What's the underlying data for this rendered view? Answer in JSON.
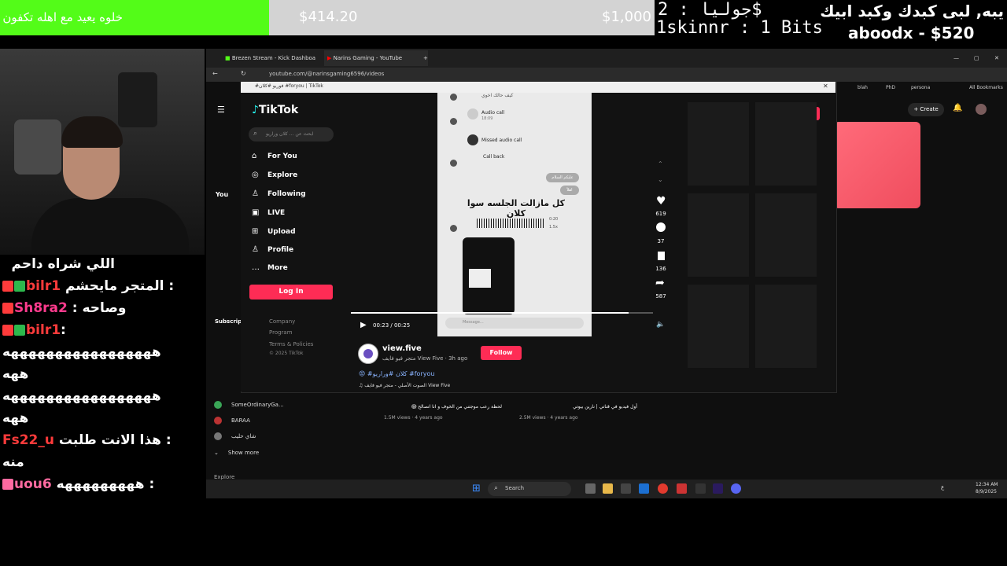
{
  "overlay": {
    "banner_text": "خلوه يعيد مع اهله تكفون",
    "bar_current": "$414.20",
    "bar_goal": "$1,000",
    "donor_mid_line1": "جوليا : 2$",
    "donor_mid_line2": "1skinnr : 1 Bits",
    "donor_right_line1": "يبه, لبى كبدك وكبد ابيك",
    "donor_right_line2": "aboodx - $520"
  },
  "chat": [
    {
      "user": "",
      "text": "اللي شراه داحم",
      "user_color": "#ffffff"
    },
    {
      "user": "bilr1",
      "text": "المتجر مايحشم :",
      "user_color": "#ff3b3b"
    },
    {
      "user": "Sh8ra2",
      "text": ": وصاحه",
      "user_color": "#ff3b8d"
    },
    {
      "user": "bilr1",
      "text": ":",
      "user_color": "#ff3b3b"
    },
    {
      "user": "",
      "text": "هههههههههههههههههه",
      "user_color": "#ffffff"
    },
    {
      "user": "",
      "text": "ههه",
      "user_color": "#ffffff"
    },
    {
      "user": "",
      "text": "هههههههههههههههههه",
      "user_color": "#ffffff"
    },
    {
      "user": "",
      "text": "ههه",
      "user_color": "#ffffff"
    },
    {
      "user": "Fs22_u",
      "text": "هذا الانت طلبت :",
      "user_color": "#ff3b3b"
    },
    {
      "user": "",
      "text": "منه",
      "user_color": "#ffffff"
    },
    {
      "user": "uou6",
      "text": "هههههههههه :",
      "user_color": "#ff6aa0"
    }
  ],
  "browser": {
    "tabs": [
      "Brezen Stream - Kick Dashboa",
      "Narins Gaming - YouTube"
    ],
    "url": "youtube.com/@narinsgaming6596/videos",
    "bookmarks": [
      "blah",
      "PhD",
      "persona",
      "All Bookmarks"
    ],
    "create_label": "Create"
  },
  "youtube_sidebar": {
    "you_label": "You",
    "subscriptions_label": "Subscrip",
    "subs": [
      "SomeOrdinaryGa...",
      "BARAA",
      "شاي حليب"
    ],
    "show_more": "Show more",
    "explore": "Explore"
  },
  "youtube_videos": [
    {
      "title": "لحظة رعب موجتني من الخوف و انا انصالح 😱",
      "meta": "1.5M views · 4 years ago"
    },
    {
      "title": "أول فيديو في قناتي | نارين بيوتي",
      "meta": "2.5M views · 4 years ago"
    }
  ],
  "tiktok": {
    "window_title": "#فوريو #كلان #foryou | TikTok",
    "logo": "TikTok",
    "search_placeholder": "ابحث عن ... كلان وراريو",
    "nav": [
      "For You",
      "Explore",
      "Following",
      "LIVE",
      "Upload",
      "Profile",
      "More"
    ],
    "login": "Log In",
    "footer": [
      "Company",
      "Program",
      "Terms & Policies",
      "© 2025 TikTok"
    ],
    "video_chat": {
      "top": "كيف حالك اخوي",
      "audio_call": "Audio call",
      "audio_time": "18:09",
      "missed": "Missed audio call",
      "call_back": "Call back",
      "bubble1": "عليكم السلام",
      "bubble2": "اهلاً",
      "caption": "كل مازالت الجلسه سوا كلان",
      "voice_len": "0:20",
      "speed": "1.5x",
      "message_placeholder": "Message..."
    },
    "time": "00:23 / 00:25",
    "progress": 0.92,
    "stats": {
      "likes": "619",
      "comments": "37",
      "saves": "136",
      "shares": "587"
    },
    "author": "view.five",
    "author_sub": "متجر فيو فايف View Five · 3h ago",
    "follow": "Follow",
    "tags": "😡 #كلان #وراريو #foryou",
    "sound": "♫ الصوت الأصلي - متجر فيو فايف View Five"
  },
  "taskbar": {
    "search": "Search",
    "time": "12:34 AM",
    "date": "8/9/2025",
    "lang": "ع"
  }
}
